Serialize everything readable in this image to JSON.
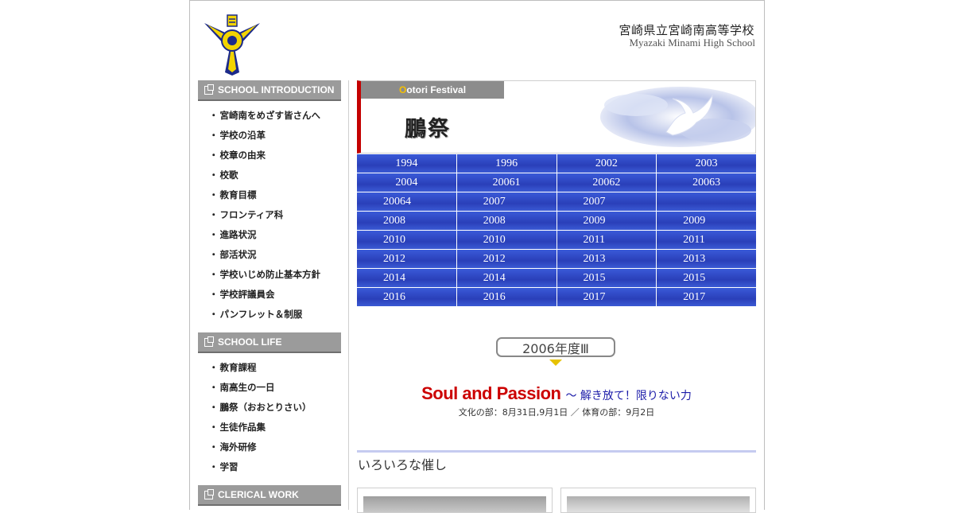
{
  "header": {
    "school_name_jp": "宮崎県立宮崎南高等学校",
    "school_name_en": "Myazaki Minami High School",
    "emblem_icon": "school-emblem-icon"
  },
  "sidebar": {
    "sections": [
      {
        "title": "SCHOOL INTRODUCTION",
        "items": [
          "宮崎南をめざす皆さんへ",
          "学校の沿革",
          "校章の由来",
          "校歌",
          "教育目標",
          "フロンティア科",
          "進路状況",
          "部活状況",
          "学校いじめ防止基本方針",
          "学校評議員会",
          "パンフレット＆制服"
        ]
      },
      {
        "title": "SCHOOL LIFE",
        "items": [
          "教育課程",
          "南高生の一日",
          "鵬祭（おおとりさい）",
          "生徒作品集",
          "海外研修",
          "学習"
        ]
      },
      {
        "title": "CLERICAL WORK",
        "items": []
      }
    ]
  },
  "main": {
    "banner_tab_first": "O",
    "banner_tab_rest": "otori Festival",
    "banner_title": "鵬祭",
    "year_links": [
      "1994",
      "1996",
      "2002",
      "2003",
      "2004",
      "20061",
      "20062",
      "20063",
      "20064",
      "2007",
      "2007",
      "",
      "2008",
      "2008",
      "2009",
      "2009",
      "2010",
      "2010",
      "2011",
      "2011",
      "2012",
      "2012",
      "2013",
      "2013",
      "2014",
      "2014",
      "2015",
      "2015",
      "2016",
      "2016",
      "2017",
      "2017"
    ],
    "year_badge": "2006年度Ⅲ",
    "headline_main": "Soul and Passion",
    "headline_sub": "～ 解き放て！限りない力",
    "dates": "文化の部：8月31日,9月1日 ／ 体育の部：9月2日",
    "events_title": "いろいろな催し"
  },
  "colors": {
    "accent_red": "#c40000",
    "grid_blue": "#2a3fb9",
    "sidebar_gray": "#9b9b9b",
    "headline_red": "#cc0000",
    "headline_blue": "#1a1aa8"
  }
}
